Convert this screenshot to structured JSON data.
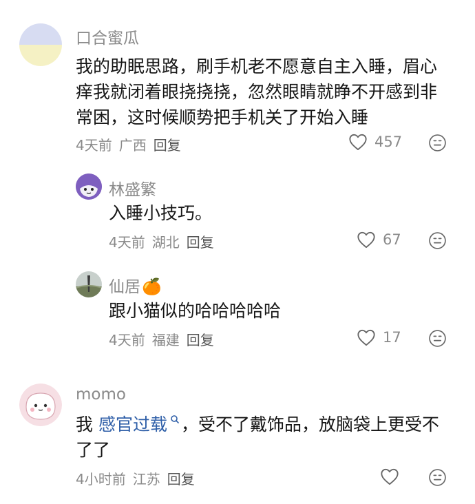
{
  "comments": [
    {
      "author": "口合蜜瓜",
      "text": "我的助眠思路，刷手机老不愿意自主入睡，眉心痒我就闭着眼挠挠挠，忽然眼睛就睁不开感到非常困，这时候顺势把手机关了开始入睡",
      "time": "4天前",
      "location": "广西",
      "reply_label": "回复",
      "likes": "457",
      "replies": [
        {
          "author": "林盛繁",
          "text": "入睡小技巧。",
          "time": "4天前",
          "location": "湖北",
          "reply_label": "回复",
          "likes": "67"
        },
        {
          "author": "仙居",
          "author_emoji": "🍊",
          "text": "跟小猫似的哈哈哈哈哈",
          "time": "4天前",
          "location": "福建",
          "reply_label": "回复",
          "likes": "17"
        }
      ]
    },
    {
      "author": "momo",
      "text_prefix": "我 ",
      "link_text": "感官过载",
      "text_suffix": "，受不了戴饰品，放脑袋上更受不了了",
      "time": "4小时前",
      "location": "江苏",
      "reply_label": "回复",
      "likes": ""
    }
  ],
  "icons": {
    "like": "heart-outline-icon",
    "react": "neutral-face-icon",
    "search": "search-icon"
  },
  "colors": {
    "link": "#2f5fa8",
    "meta": "#8a8a8a"
  }
}
